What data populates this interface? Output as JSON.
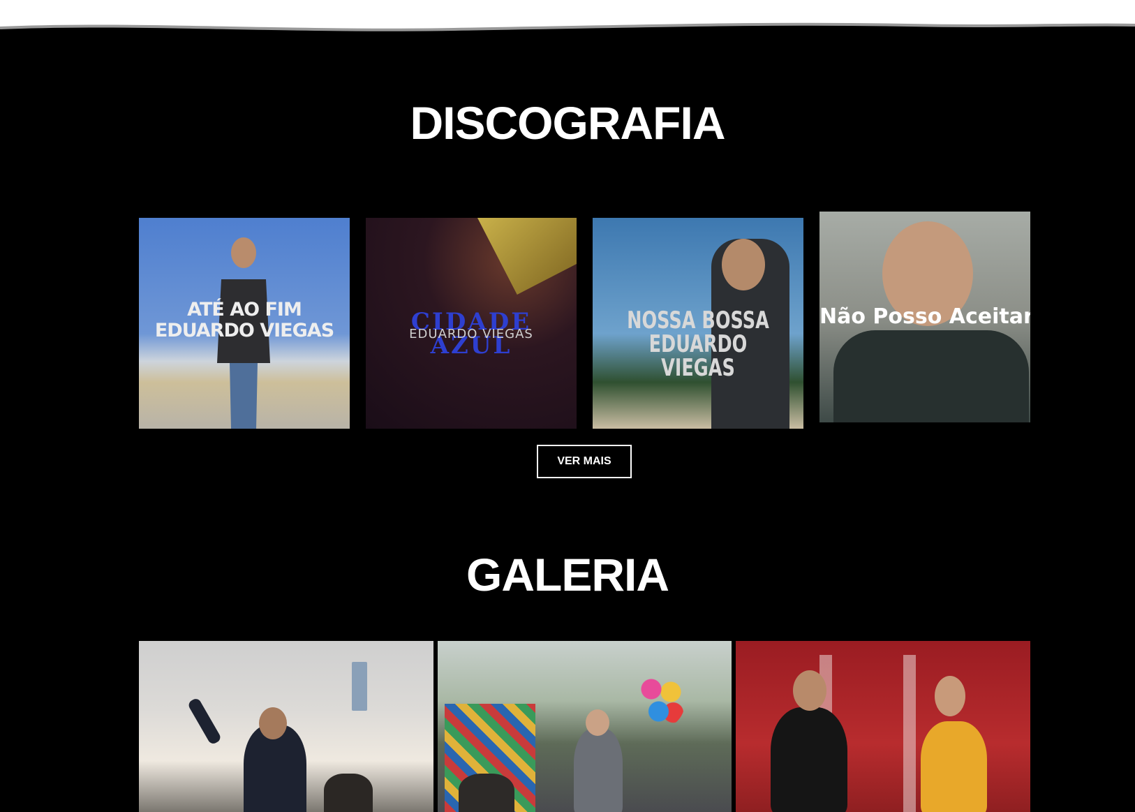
{
  "sections": {
    "discografia": {
      "title": "DISCOGRAFIA"
    },
    "galeria": {
      "title": "GALERIA"
    }
  },
  "covers": [
    {
      "line1": "ATÉ AO FIM",
      "line2": "EDUARDO VIEGAS"
    },
    {
      "line1": "CIDADE AZUL",
      "line2": "EDUARDO VIEGAS"
    },
    {
      "line1": "NOSSA BOSSA",
      "line2": "EDUARDO VIEGAS"
    },
    {
      "line1": "Não Posso Aceitar"
    }
  ],
  "buttons": {
    "ver_mais": "VER MAIS"
  },
  "colors": {
    "background": "#000000",
    "text": "#ffffff"
  }
}
